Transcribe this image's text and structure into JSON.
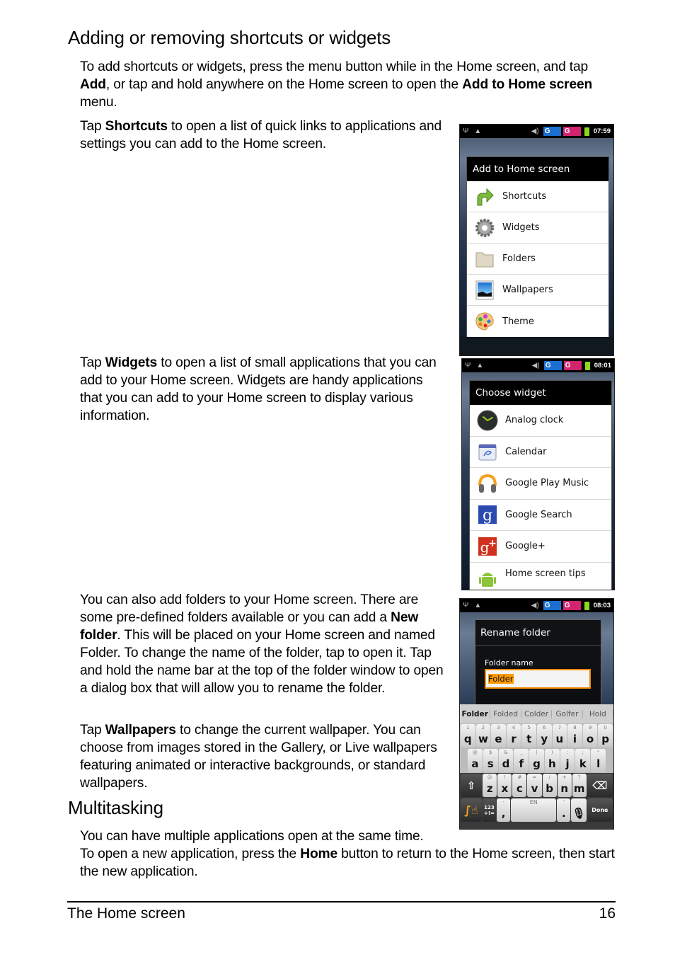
{
  "section1": {
    "heading": "Adding or removing shortcuts or widgets",
    "intro": {
      "t1": "To add shortcuts or widgets, press the menu button while in the Home screen, and tap ",
      "b1": "Add",
      "t2": ", or tap and hold anywhere on the Home screen to open the ",
      "b2": "Add to Home screen",
      "t3": " menu."
    },
    "shortcuts": {
      "t1": "Tap ",
      "b1": "Shortcuts",
      "t2": " to open a list of quick links to applications and settings you can add to the Home screen."
    },
    "widgets": {
      "t1": "Tap ",
      "b1": "Widgets",
      "t2": " to open a list of small applications that you can add to your Home screen. Widgets are handy applications that you can add to your Home screen to display various information."
    },
    "folders": {
      "t1": "You can also add folders to your Home screen. There are some pre-defined folders available or you can add a ",
      "b1": "New folder",
      "t2": ". This will be placed on your Home screen and named Folder. To change the name of the folder, tap to open it. Tap and hold the name bar at the top of the folder window to open a dialog box that will allow you to rename the folder."
    },
    "wallpapers": {
      "t1": "Tap ",
      "b1": "Wallpapers",
      "t2": " to change the current wallpaper. You can choose from images stored in the Gallery, or Live wallpapers featuring animated or interactive backgrounds, or standard wallpapers."
    }
  },
  "section2": {
    "heading": "Multitasking",
    "p1": "You can have multiple applications open at the same time.",
    "p2": {
      "t1": "To open a new application, press the ",
      "b1": "Home",
      "t2": " button to return to the Home screen, then start the new application."
    }
  },
  "footer": {
    "chapter": "The Home screen",
    "page": "16"
  },
  "screens": {
    "add_to_home": {
      "time": "07:59",
      "title": "Add to Home screen",
      "items": [
        {
          "label": "Shortcuts",
          "icon": "arrow-icon"
        },
        {
          "label": "Widgets",
          "icon": "gear-icon"
        },
        {
          "label": "Folders",
          "icon": "folder-icon"
        },
        {
          "label": "Wallpapers",
          "icon": "wallpaper-icon"
        },
        {
          "label": "Theme",
          "icon": "palette-icon"
        }
      ]
    },
    "choose_widget": {
      "time": "08:01",
      "title": "Choose widget",
      "items": [
        {
          "label": "Analog clock",
          "icon": "clock-icon"
        },
        {
          "label": "Calendar",
          "icon": "calendar-icon"
        },
        {
          "label": "Google Play Music",
          "icon": "headphones-icon"
        },
        {
          "label": "Google Search",
          "icon": "google-search-icon"
        },
        {
          "label": "Google+",
          "icon": "google-plus-icon"
        },
        {
          "label": "Home screen tips",
          "icon": "android-icon"
        }
      ]
    },
    "rename_folder": {
      "time": "08:03",
      "title": "Rename folder",
      "field_label": "Folder name",
      "field_value": "Folder",
      "suggestions": [
        "Folder",
        "Folded",
        "Colder",
        "Golfer",
        "Hold"
      ],
      "row1": [
        [
          "q",
          "1"
        ],
        [
          "w",
          "2"
        ],
        [
          "e",
          "3"
        ],
        [
          "r",
          "4"
        ],
        [
          "t",
          "5"
        ],
        [
          "y",
          "6"
        ],
        [
          "u",
          "7"
        ],
        [
          "i",
          "8"
        ],
        [
          "o",
          "9"
        ],
        [
          "p",
          "0"
        ]
      ],
      "row2": [
        [
          "a",
          "@"
        ],
        [
          "s",
          "$"
        ],
        [
          "d",
          "&"
        ],
        [
          "f",
          "_"
        ],
        [
          "g",
          "("
        ],
        [
          "h",
          ")"
        ],
        [
          "j",
          ":"
        ],
        [
          "k",
          ";"
        ],
        [
          "l",
          "\""
        ]
      ],
      "row3": [
        [
          "z",
          "☺"
        ],
        [
          "x",
          "!"
        ],
        [
          "c",
          "#"
        ],
        [
          "v",
          "="
        ],
        [
          "b",
          "/"
        ],
        [
          "n",
          "+"
        ],
        [
          "m",
          "?"
        ]
      ],
      "sym_key": "123\n+!=",
      "space_label": "EN",
      "comma_key": ",",
      "comma_alt": "-",
      "period_key": ".",
      "period_alt": "'",
      "done_label": "Done"
    },
    "network": {
      "label1": "G",
      "label2": "G"
    }
  }
}
